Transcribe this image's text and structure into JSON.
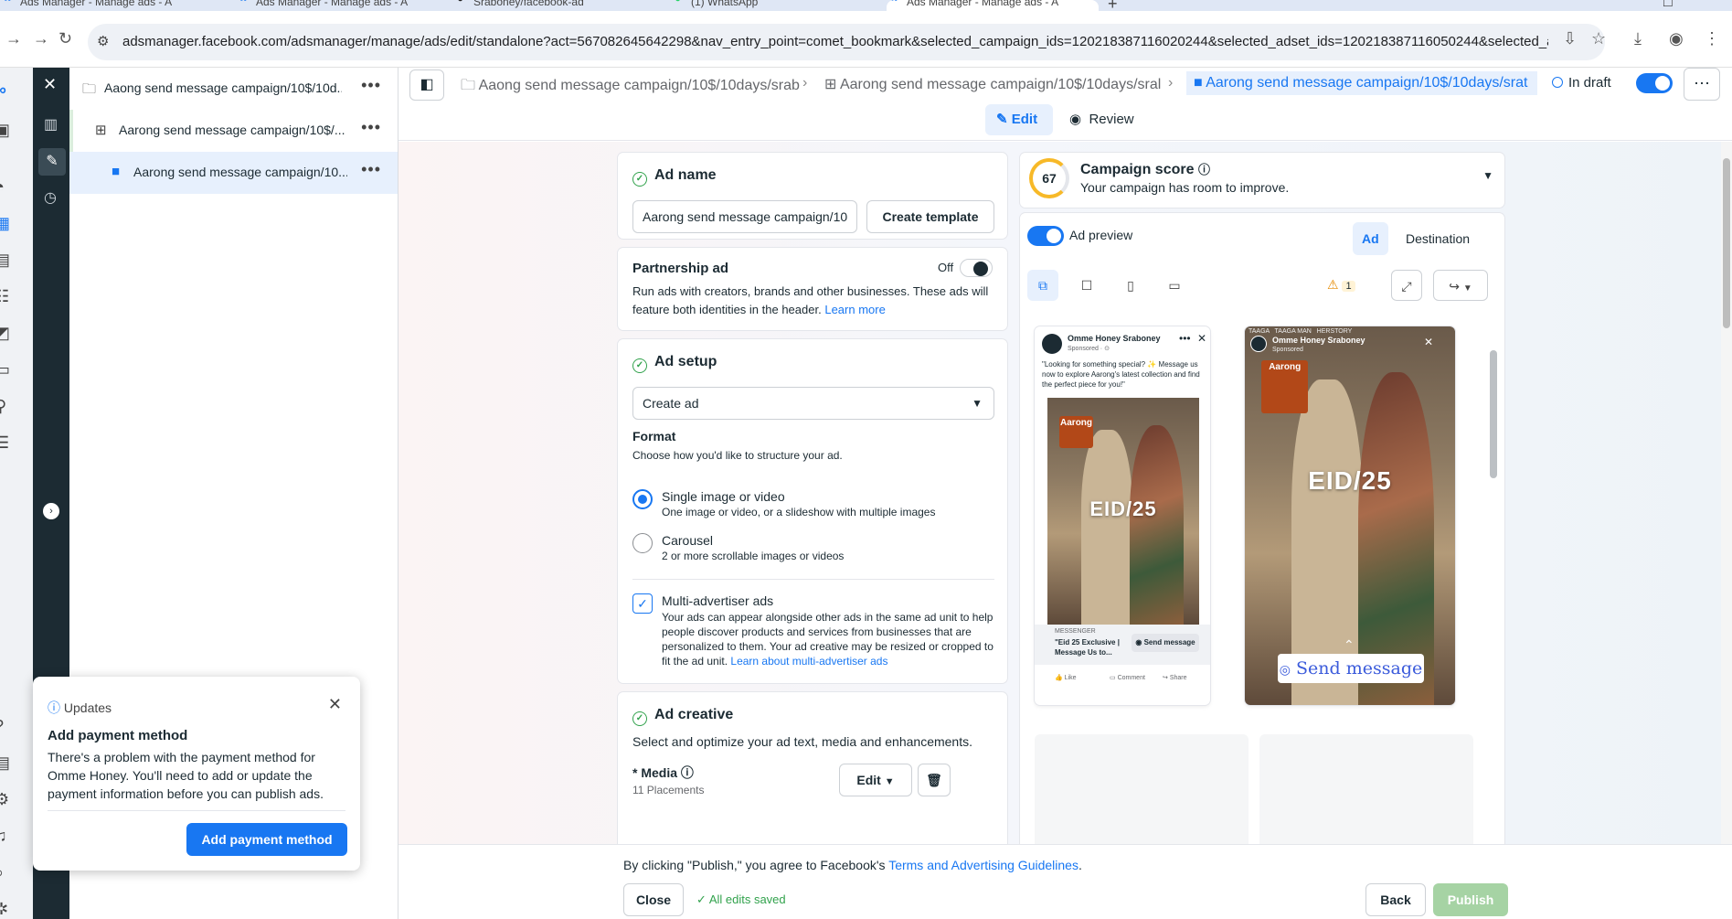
{
  "browser": {
    "tabs": [
      {
        "title": "Ads Manager - Manage ads - A"
      },
      {
        "title": "Ads Manager - Manage ads - A"
      },
      {
        "title": "Sraboney/facebook-ad"
      },
      {
        "title": "(1) WhatsApp"
      },
      {
        "title": "Ads Manager - Manage ads - A"
      }
    ],
    "url": "adsmanager.facebook.com/adsmanager/manage/ads/edit/standalone?act=567082645642298&nav_entry_point=comet_bookmark&selected_campaign_ids=120218387116020244&selected_adset_ids=120218387116050244&selected_ad_ids=120218387..."
  },
  "tree": {
    "campaign": "Aaong send message campaign/10$/10d...",
    "adset": "Aarong send message campaign/10$/...",
    "ad": "Aarong send message campaign/10..."
  },
  "header": {
    "crumbs": [
      "Aaong send message campaign/10$/10days/srab",
      "Aarong send message campaign/10$/10days/sral",
      "Aarong send message campaign/10$/10days/srat"
    ],
    "status": "In draft",
    "edit": "Edit",
    "review": "Review"
  },
  "ad_name": {
    "title": "Ad name",
    "value": "Aarong send message campaign/10",
    "template_button": "Create template"
  },
  "partnership": {
    "title": "Partnership ad",
    "toggle_label": "Off",
    "desc": "Run ads with creators, brands and other businesses. These ads will feature both identities in the header.",
    "learn_more": "Learn more"
  },
  "ad_setup": {
    "title": "Ad setup",
    "select_value": "Create ad",
    "format_title": "Format",
    "format_desc": "Choose how you'd like to structure your ad.",
    "option1_title": "Single image or video",
    "option1_desc": "One image or video, or a slideshow with multiple images",
    "option2_title": "Carousel",
    "option2_desc": "2 or more scrollable images or videos",
    "multi_title": "Multi-advertiser ads",
    "multi_desc": "Your ads can appear alongside other ads in the same ad unit to help people discover products and services from businesses that are personalized to them. Your ad creative may be resized or cropped to fit the ad unit.",
    "multi_link": "Learn about multi-advertiser ads"
  },
  "ad_creative": {
    "title": "Ad creative",
    "desc": "Select and optimize your ad text, media and enhancements.",
    "media_label": "* Media",
    "placements": "11 Placements",
    "edit_button": "Edit"
  },
  "score": {
    "value": "67",
    "title": "Campaign score",
    "subtitle": "Your campaign has room to improve."
  },
  "preview": {
    "toggle_label": "Ad preview",
    "tab_ad": "Ad",
    "tab_destination": "Destination",
    "warning_count": "1",
    "feed": {
      "page_name": "Omme Honey Sraboney",
      "sponsored": "Sponsored · ⊙",
      "primary_text": "\"Looking for something special? ✨ Message us now to explore Aarong's latest collection and find the perfect piece for you!\"",
      "brand": "Aarong",
      "overlay": "EID/25",
      "source": "MESSENGER",
      "headline": "\"Eid 25 Exclusive | Message Us to...",
      "cta": "Send message",
      "like": "Like",
      "comment": "Comment",
      "share": "Share"
    },
    "story": {
      "page_name": "Omme Honey Sraboney",
      "sponsored": "Sponsored",
      "header_text": "TAAGA   TAAGA MAN   HERSTORY",
      "brand": "Aarong",
      "overlay": "EID/25",
      "cta": "Send message"
    }
  },
  "updates": {
    "label": "Updates",
    "title": "Add payment method",
    "body": "There's a problem with the payment method for Omme Honey. You'll need to add or update the payment information before you can publish ads.",
    "button": "Add payment method"
  },
  "footer": {
    "notice_prefix": "By clicking \"Publish,\" you agree to Facebook's",
    "notice_link": "Terms and Advertising Guidelines",
    "notice_suffix": ".",
    "close": "Close",
    "saved": "All edits saved",
    "back": "Back",
    "publish": "Publish"
  }
}
